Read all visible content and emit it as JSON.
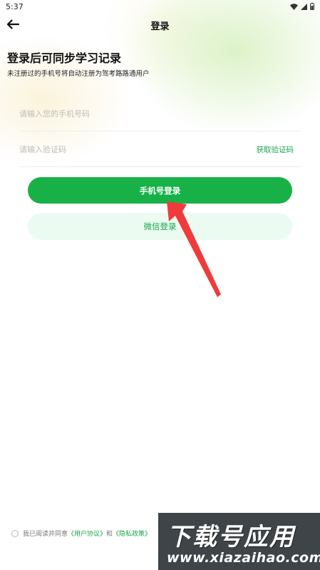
{
  "status_bar": {
    "time": "5:37"
  },
  "header": {
    "title": "登录"
  },
  "intro": {
    "heading": "登录后可同步学习记录",
    "subheading": "未注册过的手机号将自动注册为驾考路路通用户"
  },
  "form": {
    "phone_placeholder": "请输入您的手机号码",
    "code_placeholder": "请输入验证码",
    "get_code_label": "获取验证码"
  },
  "buttons": {
    "phone_login": "手机号登录",
    "wechat_login": "微信登录"
  },
  "agreement": {
    "prefix": "我已阅读并同意",
    "user_agreement": "《用户协议》",
    "and": "和",
    "privacy_policy": "《隐私政策》"
  },
  "watermark": {
    "line1": "下载号应用",
    "line2": "www.xiazaihao.com"
  },
  "colors": {
    "accent": "#18b148",
    "accent_light": "#ebfbf2",
    "annotation_arrow": "#ef3b3b"
  }
}
